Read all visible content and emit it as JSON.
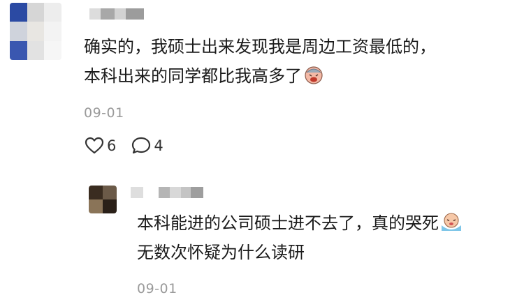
{
  "comment1": {
    "text_line1": "确实的，我硕士出来发现我是周边工资最低的，",
    "text_line2": "本科出来的同学都比我高多了",
    "emoji": "crying-face-emoji",
    "date": "09-01",
    "likes": "6",
    "replies": "4"
  },
  "reply1": {
    "text_line1": "本科能进的公司硕士进不去了，真的哭死",
    "text_line2": "无数次怀疑为什么读研",
    "emoji": "crying-tears-emoji",
    "date": "09-01"
  },
  "icons": {
    "like": "heart-icon",
    "comment": "speech-bubble-icon"
  },
  "colors": {
    "text": "#1a1a1a",
    "meta": "#9a9a9a"
  }
}
